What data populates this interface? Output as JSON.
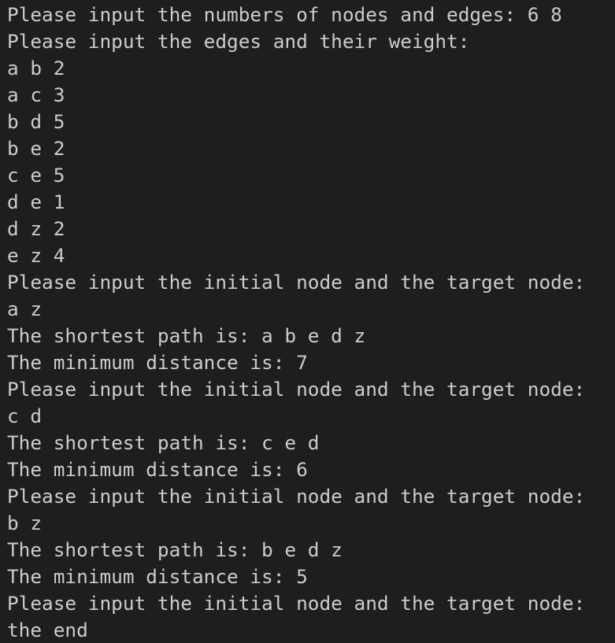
{
  "terminal": {
    "lines": [
      "Please input the numbers of nodes and edges: 6 8",
      "Please input the edges and their weight:",
      "a b 2",
      "a c 3",
      "b d 5",
      "b e 2",
      "c e 5",
      "d e 1",
      "d z 2",
      "e z 4",
      "Please input the initial node and the target node:",
      "a z",
      "The shortest path is: a b e d z",
      "The minimum distance is: 7",
      "Please input the initial node and the target node:",
      "c d",
      "The shortest path is: c e d",
      "The minimum distance is: 6",
      "Please input the initial node and the target node:",
      "b z",
      "The shortest path is: b e d z",
      "The minimum distance is: 5",
      "Please input the initial node and the target node:",
      "the end"
    ]
  },
  "colors": {
    "background": "#1e1e1e",
    "text": "#cccccc"
  }
}
